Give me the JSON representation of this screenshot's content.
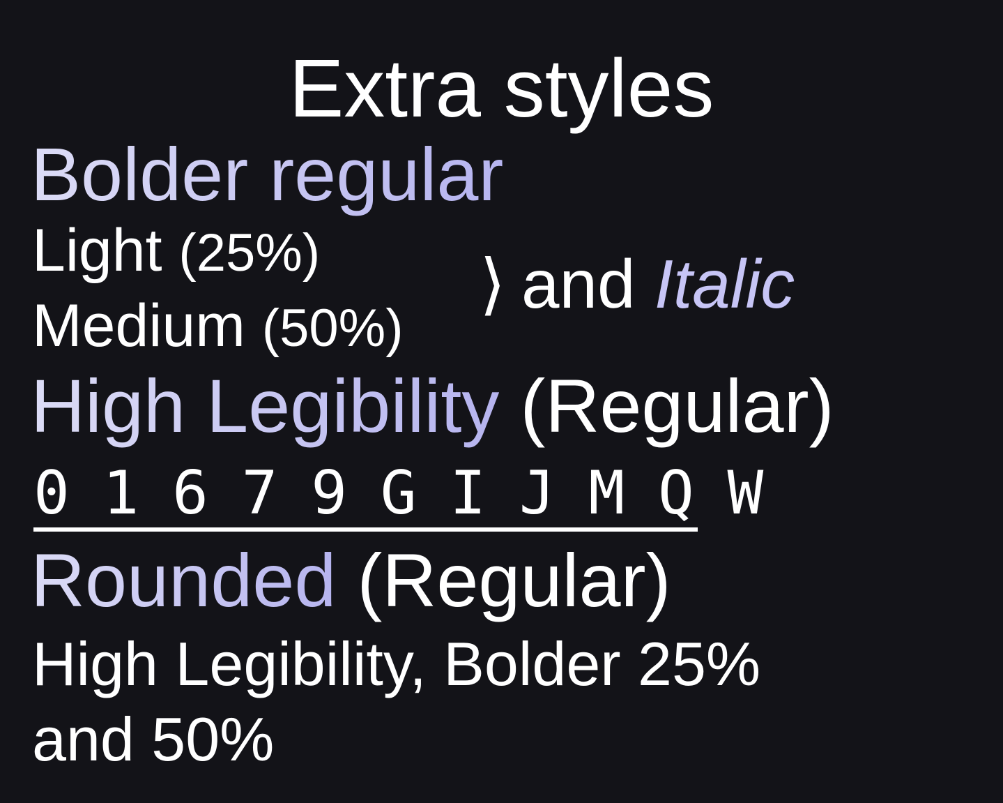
{
  "title": "Extra styles",
  "bolder": {
    "heading": "Bolder regular",
    "light_label": "Light",
    "light_pct": "(25%)",
    "medium_label": "Medium",
    "medium_pct": "(50%)",
    "brace": "⟩",
    "and": "and",
    "italic": "Italic"
  },
  "high_legibility": {
    "heading": "High Legibility",
    "weight": "(Regular)",
    "glyphs": "0 1 6 7 9 G I J M Q W"
  },
  "rounded": {
    "heading": "Rounded",
    "weight": "(Regular)",
    "line1": "High Legibility, Bolder 25%",
    "line2": "and 50%"
  },
  "colors": {
    "background": "#131318",
    "accent_start": "#dcdcf6",
    "accent_end": "#b6b4ef",
    "text": "#ffffff"
  }
}
